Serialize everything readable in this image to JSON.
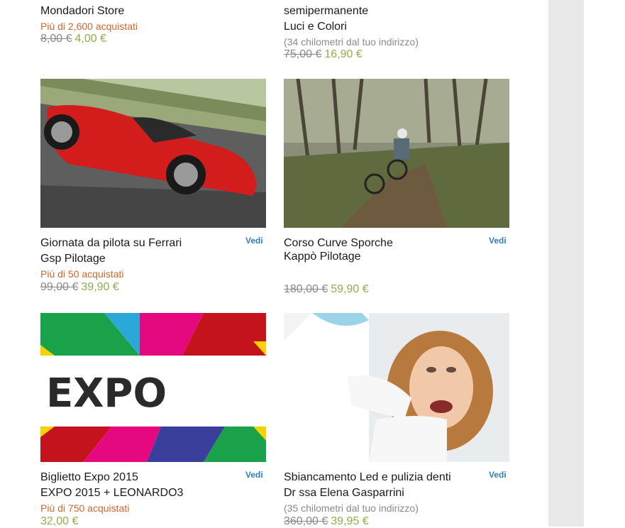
{
  "deals": [
    {
      "title1": "Mondadori Store",
      "title2": "",
      "sold": "Più di 2,600 acquistati",
      "distance": "",
      "old_price": "8,00 €",
      "new_price": "4,00 €",
      "vedi": ""
    },
    {
      "title1": "semipermanente",
      "title2": "Luci e Colori",
      "sold": "",
      "distance": "(34 chilometri dal tuo indirizzo)",
      "old_price": "75,00 €",
      "new_price": "16,90 €",
      "vedi": ""
    },
    {
      "title1": "Giornata da pilota su Ferrari",
      "title2": "Gsp Pilotage",
      "sold": "Più di 50 acquistati",
      "distance": "",
      "old_price": "99,00 €",
      "new_price": "39,90 €",
      "vedi": "Vedi",
      "image": "red-sports-car-photo"
    },
    {
      "title1": "Corso  Curve Sporche",
      "title2": " Kappò  Pilotage",
      "sold": "",
      "distance": "",
      "old_price": "180,00 €",
      "new_price": "59,90 €",
      "vedi": "Vedi",
      "image": "mountain-bike-forest-photo"
    },
    {
      "title1": "Biglietto Expo 2015",
      "title2": "EXPO 2015 + LEONARDO3",
      "sold": "Più di 750 acquistati",
      "distance": "",
      "old_price": "",
      "new_price": "32,00 €",
      "vedi": "Vedi",
      "image": "expo-logo-image",
      "logo_text": "EXPO"
    },
    {
      "title1": "Sbiancamento Led e pulizia denti",
      "title2": "Dr ssa Elena Gasparrini",
      "sold": "",
      "distance": "(35 chilometri dal tuo indirizzo)",
      "old_price": "360,00 €",
      "new_price": "39,95 €",
      "vedi": "Vedi",
      "image": "dentist-patient-photo"
    }
  ],
  "colors": {
    "sold": "#d0662e",
    "new_price": "#8cb04a",
    "vedi": "#2d7fc0",
    "gutter": "#e8e8e8"
  }
}
